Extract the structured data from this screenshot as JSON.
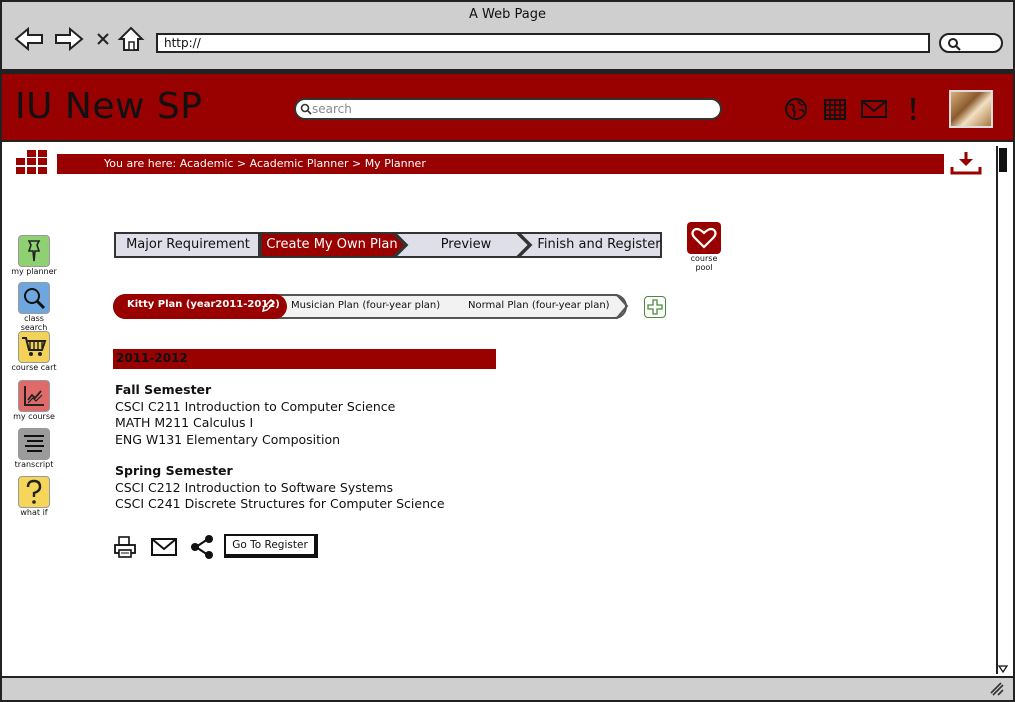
{
  "browser": {
    "window_title": "A Web Page",
    "url": "http://",
    "icons": [
      "back-arrow-icon",
      "forward-arrow-icon",
      "close-x-icon",
      "home-icon",
      "search-icon"
    ]
  },
  "header": {
    "title": "IU New SP",
    "search_placeholder": "search",
    "icons": [
      "globe-icon",
      "calendar-icon",
      "mail-icon",
      "alert-icon"
    ]
  },
  "breadcrumb": {
    "text": "You are here: Academic > Academic Planner > My Planner"
  },
  "left_nav": [
    {
      "label": "my planner",
      "icon": "pushpin-icon",
      "color": "#8fd072"
    },
    {
      "label": "class search",
      "icon": "magnifier-icon",
      "color": "#6ea6e0"
    },
    {
      "label": "course cart",
      "icon": "cart-icon",
      "color": "#f3d25a"
    },
    {
      "label": "my course",
      "icon": "chart-icon",
      "color": "#e06a6a"
    },
    {
      "label": "transcript",
      "icon": "lines-icon",
      "color": "#9b9b9b"
    },
    {
      "label": "what if",
      "icon": "question-icon",
      "color": "#f6d65a"
    }
  ],
  "wizard": {
    "steps": [
      {
        "label": "Major Requirement",
        "active": false
      },
      {
        "label": "Create My Own Plan",
        "active": true
      },
      {
        "label": "Preview",
        "active": false
      },
      {
        "label": "Finish and Register",
        "active": false
      }
    ],
    "course_pool_label": "course pool"
  },
  "plans": {
    "active": "Kitty Plan (year2011-2012)",
    "others": [
      "Musician Plan (four-year plan)",
      "Normal Plan (four-year plan)"
    ]
  },
  "year": "2011-2012",
  "semesters": [
    {
      "title": "Fall Semester",
      "courses": [
        "CSCI C211 Introduction to Computer Science",
        "MATH M211 Calculus I",
        "ENG W131 Elementary Composition"
      ]
    },
    {
      "title": "Spring Semester",
      "courses": [
        "CSCI C212 Introduction to Software Systems",
        "CSCI C241 Discrete Structures for Computer Science"
      ]
    }
  ],
  "actions": {
    "register_label": "Go To Register",
    "icons": [
      "print-icon",
      "mail-icon",
      "share-icon"
    ]
  },
  "colors": {
    "brand": "#990000",
    "chrome": "#cfcfcf",
    "step_inactive": "#dedfe8"
  }
}
